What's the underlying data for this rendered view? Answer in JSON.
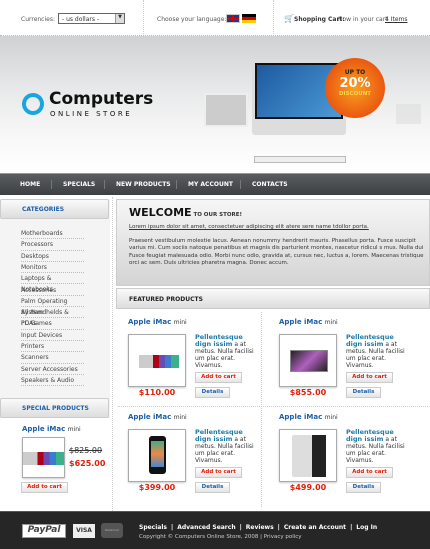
{
  "topbar": {
    "currencies_label": "Currencies:",
    "currency_value": "- us dollars -",
    "language_label": "Choose your language:",
    "cart_label": "Shopping Cart:",
    "cart_text": "Now in  your cart",
    "cart_items": "4 Items"
  },
  "banner": {
    "logo_title": "Computers",
    "logo_sub": "ONLINE STORE",
    "badge_top": "UP TO",
    "badge_value": "20%",
    "badge_bottom": "DISCOUNT"
  },
  "nav": [
    "HOME",
    "SPECIALS",
    "NEW PRODUCTS",
    "MY ACCOUNT",
    "CONTACTS"
  ],
  "sidebar": {
    "categories_title": "CATEGORIES",
    "categories": [
      "Motherboards",
      "Processors",
      "Desktops",
      "Monitors",
      "Laptops & Notebooks",
      "Accessories",
      "Palm Operating System",
      "All Handhelds & PDAs",
      "PC Games",
      "Input Devices",
      "Printers",
      "Scanners",
      "Server Accessories",
      "Speakers & Audio"
    ],
    "special_title": "SPECIAL PRODUCTS",
    "special": {
      "name": "Apple iMac",
      "name_suffix": "mini",
      "old_price": "$825.00",
      "new_price": "$625.00",
      "cart": "Add to cart"
    }
  },
  "welcome": {
    "title": "WELCOME",
    "subtitle": "TO OUR STORE!",
    "link": "Lorem ipsum dolor sit amet, consectetuer adipiscing elit atere sere name tdollor porta.",
    "body": "Praesent vestibulum molestie lacus. Aenean nonummy hendrerit mauris. Phasellus porta. Fusce suscipit varius mi. Cum sociis natoque penatibus et magnis dis parturient montes, nascetur ridicul s mus. Nulla dui Fusce feugiat malesuada odio. Morbi nunc odio, gravida at, cursus nec, luctus a, lorem. Maecenas tristique orci ac sem. Duis ultricies pharetra magna. Donec accum."
  },
  "featured": {
    "title": "FEATURED PRODUCTS",
    "products": [
      {
        "name": "Apple iMac",
        "suffix": "mini",
        "desc_link": "Pellentesque dign issim",
        "desc": " a at metus. Nulla facilisi um plac erat. Vivamus.",
        "price": "$110.00",
        "cart": "Add to cart",
        "details": "Details"
      },
      {
        "name": "Apple iMac",
        "suffix": "mini",
        "desc_link": "Pellentesque dign issim",
        "desc": " a at metus. Nulla facilisi um plac erat. Vivamus.",
        "price": "$855.00",
        "cart": "Add to cart",
        "details": "Details"
      },
      {
        "name": "Apple iMac",
        "suffix": "mini",
        "desc_link": "Pellentesque dign issim",
        "desc": " a at metus. Nulla facilisi um plac erat. Vivamus.",
        "price": "$399.00",
        "cart": "Add to cart",
        "details": "Details"
      },
      {
        "name": "Apple iMac",
        "suffix": "mini",
        "desc_link": "Pellentesque dign issim",
        "desc": " a at metus. Nulla facilisi um plac erat. Vivamus.",
        "price": "$499.00",
        "cart": "Add to cart",
        "details": "Details"
      }
    ]
  },
  "footer": {
    "links": [
      "Specials",
      "Advanced Search",
      "Reviews",
      "Create an Account",
      "Log In"
    ],
    "copyright": "Copyright © Computers Online Store, 2008 | Privacy policy",
    "payment": [
      "PayPal",
      "VISA",
      "MasterCard"
    ]
  }
}
